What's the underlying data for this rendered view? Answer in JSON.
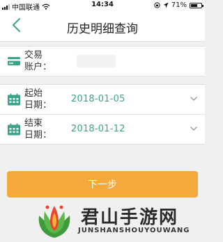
{
  "status_bar": {
    "carrier": "中国联通",
    "time": "14:34",
    "battery": "71%",
    "battery_level": 0.71
  },
  "nav": {
    "title": "历史明细查询"
  },
  "account": {
    "label_line1": "交易",
    "label_line2": "账户：",
    "value": ""
  },
  "start_date": {
    "label_line1": "起始",
    "label_line2": "日期：",
    "value": "2018-01-05"
  },
  "end_date": {
    "label_line1": "结束",
    "label_line2": "日期：",
    "value": "2018-01-12"
  },
  "actions": {
    "next_label": "下一步"
  },
  "watermark": {
    "name": "君山手游网",
    "domain": "JUNSHANSHOUYOUWANG"
  },
  "colors": {
    "accent": "#3aa38a",
    "button": "#f3a93c",
    "background": "#f0f0f0"
  }
}
